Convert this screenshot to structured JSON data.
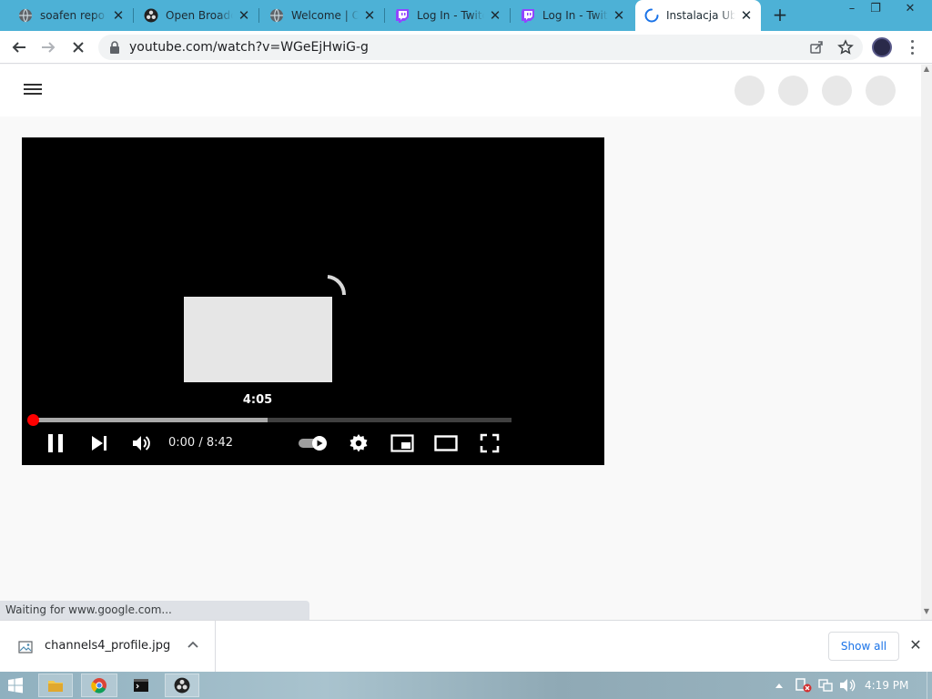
{
  "browser": {
    "tabs": [
      {
        "title": "soafen repo /",
        "icon": "globe-icon"
      },
      {
        "title": "Open Broadcast",
        "icon": "obs-icon"
      },
      {
        "title": "Welcome | OBS",
        "icon": "globe-icon"
      },
      {
        "title": "Log In - Twitch",
        "icon": "twitch-icon"
      },
      {
        "title": "Log In - Twitch",
        "icon": "twitch-icon"
      },
      {
        "title": "Instalacja Ubuntu",
        "icon": "loading-icon"
      }
    ],
    "active_tab_index": 5,
    "address": "youtube.com/watch?v=WGeEjHwiG-g",
    "status_text": "Waiting for www.google.com..."
  },
  "player": {
    "preview_time": "4:05",
    "time_display": "0:00 / 8:42",
    "hover_fraction": 0.49,
    "autoplay": "on"
  },
  "downloads": {
    "filename": "channels4_profile.jpg",
    "show_all_label": "Show all"
  },
  "taskbar": {
    "time": "4:19 PM",
    "apps": [
      "file-explorer-icon",
      "chrome-icon",
      "terminal-icon",
      "obs-icon"
    ]
  },
  "colors": {
    "tabstrip": "#4db1d6",
    "progress": "#ff0000",
    "link": "#1a73e8"
  }
}
